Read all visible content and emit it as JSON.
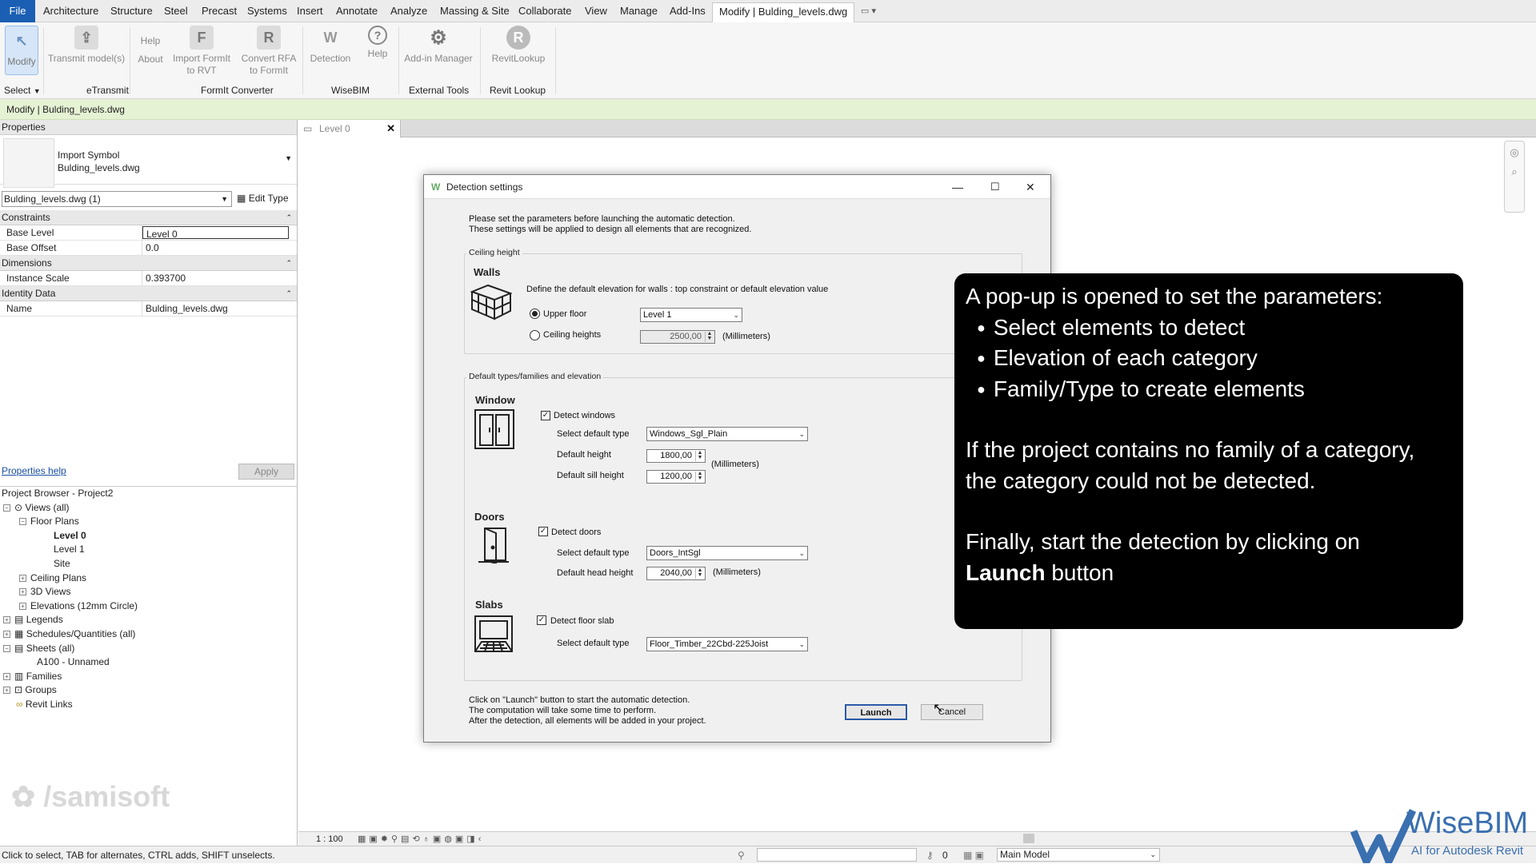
{
  "ribbon": {
    "tabs": [
      "File",
      "Architecture",
      "Structure",
      "Steel",
      "Precast",
      "Systems",
      "Insert",
      "Annotate",
      "Analyze",
      "Massing & Site",
      "Collaborate",
      "View",
      "Manage",
      "Add-Ins",
      "Modify | Bulding_levels.dwg"
    ],
    "buttons": {
      "modify": "Modify",
      "transmit": "Transmit model(s)",
      "help_top": "Help",
      "about": "About",
      "import_formit_1": "Import FormIt",
      "import_formit_2": "to RVT",
      "convert_rfa_1": "Convert RFA",
      "convert_rfa_2": "to FormIt",
      "detection": "Detection",
      "help": "Help",
      "addin_manager": "Add-in Manager",
      "revitlookup": "RevitLookup"
    },
    "groups": [
      "Select",
      "eTransmit",
      "FormIt Converter",
      "WiseBIM",
      "External Tools",
      "Revit Lookup"
    ]
  },
  "context_bar": "Modify | Bulding_levels.dwg",
  "properties": {
    "title": "Properties",
    "type_name_1": "Import Symbol",
    "type_name_2": "Bulding_levels.dwg",
    "selector": "Bulding_levels.dwg (1)",
    "edit_type": "Edit Type",
    "sections": {
      "constraints": "Constraints",
      "dimensions": "Dimensions",
      "identity": "Identity Data"
    },
    "rows": {
      "base_level_k": "Base Level",
      "base_level_v": "Level 0",
      "base_offset_k": "Base Offset",
      "base_offset_v": "0.0",
      "instance_scale_k": "Instance Scale",
      "instance_scale_v": "0.393700",
      "name_k": "Name",
      "name_v": "Bulding_levels.dwg"
    },
    "help_link": "Properties help",
    "apply": "Apply"
  },
  "browser": {
    "title": "Project Browser - Project2",
    "views": "Views (all)",
    "floor_plans": "Floor Plans",
    "level0": "Level 0",
    "level1": "Level 1",
    "site": "Site",
    "ceiling_plans": "Ceiling Plans",
    "views3d": "3D Views",
    "elevations": "Elevations (12mm Circle)",
    "legends": "Legends",
    "schedules": "Schedules/Quantities (all)",
    "sheets": "Sheets (all)",
    "a100": "A100 - Unnamed",
    "families": "Families",
    "groups": "Groups",
    "revit_links": "Revit Links"
  },
  "watermark": "/samisoft",
  "view_tab": "Level 0",
  "dialog": {
    "title": "Detection settings",
    "intro_1": "Please set the parameters before launching the automatic detection.",
    "intro_2": "These settings will be applied to design all elements that are recognized.",
    "ceiling_section": "Ceiling height",
    "walls": "Walls",
    "walls_desc": "Define the default elevation for walls : top constraint or default elevation value",
    "upper_floor": "Upper floor",
    "upper_floor_value": "Level 1",
    "ceiling_heights": "Ceiling heights",
    "ceiling_value": "2500,00",
    "mm": "(Millimeters)",
    "types_section": "Default types/families and elevation",
    "window": "Window",
    "detect_windows": "Detect windows",
    "select_default_type": "Select default type",
    "window_type": "Windows_Sgl_Plain",
    "default_height": "Default height",
    "window_height": "1800,00",
    "default_sill": "Default sill height",
    "window_sill": "1200,00",
    "doors": "Doors",
    "detect_doors": "Detect doors",
    "door_type": "Doors_IntSgl",
    "default_head": "Default head height",
    "door_head": "2040,00",
    "slabs": "Slabs",
    "detect_slab": "Detect floor slab",
    "slab_type": "Floor_Timber_22Cbd-225Joist",
    "footer_1": "Click on \"Launch\" button to start the automatic detection.",
    "footer_2": "The computation will take some time to perform.",
    "footer_3": "After the detection, all elements will be added in your project.",
    "launch": "Launch",
    "cancel": "Cancel"
  },
  "overlay": {
    "line1": "A pop-up is opened to set the parameters:",
    "bullets": [
      "Select elements to detect",
      "Elevation of each category",
      "Family/Type to create elements"
    ],
    "para2": "If the project contains no family of a category, the category could not be detected.",
    "para3_pre": "Finally, start the detection by clicking on",
    "para3_bold": "Launch",
    "para3_post": " button"
  },
  "view_bar": {
    "scale": "1 : 100"
  },
  "status": {
    "hint": "Click to select, TAB for alternates, CTRL adds, SHIFT unselects.",
    "model": "Main Model",
    "zero": "0"
  },
  "brand": {
    "name": "WiseBIM",
    "tagline": "AI for Autodesk Revit"
  },
  "colors": {
    "file_tab": "#1a5fb4",
    "context_bar": "#e6f2d4",
    "overlay": "#000000",
    "brand_blue": "#3a6fb0"
  }
}
